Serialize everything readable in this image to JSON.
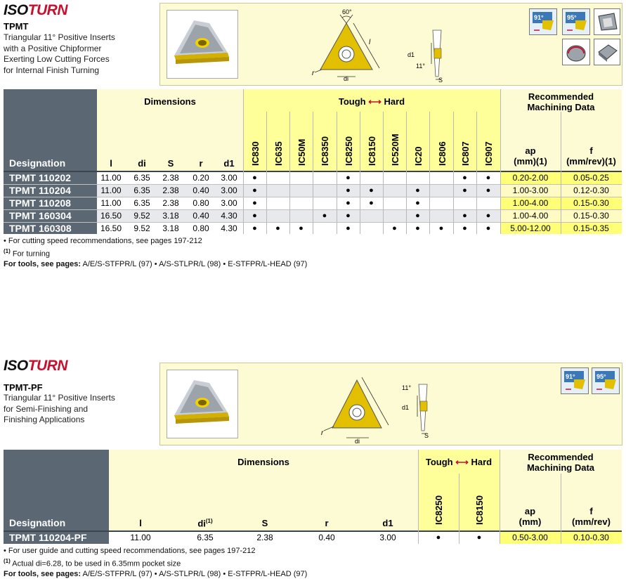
{
  "section1": {
    "logo": {
      "iso": "ISO",
      "turn": "TURN"
    },
    "title": "TPMT",
    "desc": [
      "Triangular 11° Positive Inserts",
      "with a Positive Chipformer",
      "Exerting Low Cutting Forces",
      "for Internal Finish Turning"
    ],
    "drawing": {
      "angle_top": "60°",
      "l": "l",
      "r": "r",
      "di": "di",
      "d1": "d1",
      "angle_side": "11°",
      "s": "S"
    },
    "icons": [
      {
        "label": "91°",
        "name": "tool-91-icon"
      },
      {
        "label": "95°",
        "name": "tool-95-icon"
      },
      {
        "label": "",
        "name": "insert-shape-icon"
      },
      {
        "label": "",
        "name": "boring-icon"
      },
      {
        "label": "",
        "name": "insert-seat-icon"
      }
    ],
    "headers": {
      "dimensions": "Dimensions",
      "tough": "Tough",
      "hard": "Hard",
      "rec1": "Recommended",
      "rec2": "Machining Data",
      "designation": "Designation",
      "dim_cols": [
        "l",
        "di",
        "S",
        "r",
        "d1"
      ],
      "grades": [
        "IC830",
        "IC635",
        "IC50M",
        "IC8350",
        "IC8250",
        "IC8150",
        "IC520M",
        "IC20",
        "IC806",
        "IC807",
        "IC907"
      ],
      "ap1": "ap",
      "ap2": "(mm)(1)",
      "f1": "f",
      "f2": "(mm/rev)(1)"
    },
    "rows": [
      {
        "designation": "TPMT 110202",
        "l": "11.00",
        "di": "6.35",
        "s": "2.38",
        "r": "0.20",
        "d1": "3.00",
        "grades": [
          1,
          0,
          0,
          0,
          1,
          0,
          0,
          0,
          0,
          1,
          1
        ],
        "ap": "0.20-2.00",
        "f": "0.05-0.25"
      },
      {
        "designation": "TPMT 110204",
        "l": "11.00",
        "di": "6.35",
        "s": "2.38",
        "r": "0.40",
        "d1": "3.00",
        "grades": [
          1,
          0,
          0,
          0,
          1,
          1,
          0,
          1,
          0,
          1,
          1
        ],
        "ap": "1.00-3.00",
        "f": "0.12-0.30"
      },
      {
        "designation": "TPMT 110208",
        "l": "11.00",
        "di": "6.35",
        "s": "2.38",
        "r": "0.80",
        "d1": "3.00",
        "grades": [
          1,
          0,
          0,
          0,
          1,
          1,
          0,
          1,
          0,
          0,
          0
        ],
        "ap": "1.00-4.00",
        "f": "0.15-0.30"
      },
      {
        "designation": "TPMT 160304",
        "l": "16.50",
        "di": "9.52",
        "s": "3.18",
        "r": "0.40",
        "d1": "4.30",
        "grades": [
          1,
          0,
          0,
          1,
          1,
          0,
          0,
          1,
          0,
          1,
          1
        ],
        "ap": "1.00-4.00",
        "f": "0.15-0.30"
      },
      {
        "designation": "TPMT 160308",
        "l": "16.50",
        "di": "9.52",
        "s": "3.18",
        "r": "0.80",
        "d1": "4.30",
        "grades": [
          1,
          1,
          1,
          0,
          1,
          0,
          1,
          1,
          1,
          1,
          1
        ],
        "ap": "5.00-12.00",
        "f": "0.15-0.35"
      }
    ],
    "dot": "●",
    "footnotes": {
      "f1": "• For cutting speed recommendations, see pages 197-212",
      "f2_mark": "(1)",
      "f2": " For turning",
      "tools_label": "For tools, see pages:",
      "tools": " A/E/S-STFPR/L (97) • A/S-STLPR/L (98) • E-STFPR/L-HEAD (97)"
    }
  },
  "section2": {
    "logo": {
      "iso": "ISO",
      "turn": "TURN"
    },
    "title": "TPMT-PF",
    "desc": [
      "Triangular 11° Positive Inserts",
      "for Semi-Finishing and",
      "Finishing Applications"
    ],
    "drawing": {
      "r": "r",
      "di": "di",
      "d1": "d1",
      "angle_side": "11°",
      "s": "S"
    },
    "icons": [
      {
        "label": "91°",
        "name": "tool-91-icon"
      },
      {
        "label": "95°",
        "name": "tool-95-icon"
      }
    ],
    "headers": {
      "dimensions": "Dimensions",
      "tough": "Tough",
      "hard": "Hard",
      "rec1": "Recommended",
      "rec2": "Machining Data",
      "designation": "Designation",
      "dim_l": "l",
      "dim_di": "di",
      "dim_di_mark": "(1)",
      "dim_s": "S",
      "dim_r": "r",
      "dim_d1": "d1",
      "grades": [
        "IC8250",
        "IC8150"
      ],
      "ap1": "ap",
      "ap2": "(mm)",
      "f1": "f",
      "f2": "(mm/rev)"
    },
    "row": {
      "designation": "TPMT 110204-PF",
      "l": "11.00",
      "di": "6.35",
      "s": "2.38",
      "r": "0.40",
      "d1": "3.00",
      "g1": "●",
      "g2": "●",
      "ap": "0.50-3.00",
      "f": "0.10-0.30"
    },
    "footnotes": {
      "f1": "• For user guide and cutting speed recommendations, see pages 197-212",
      "f2_mark": "(1)",
      "f2": " Actual di=6.28, to be used in 6.35mm pocket size",
      "tools_label": "For tools, see pages:",
      "tools": " A/E/S-STFPR/L (97) • A/S-STLPR/L (98) • E-STFPR/L-HEAD (97)"
    }
  }
}
